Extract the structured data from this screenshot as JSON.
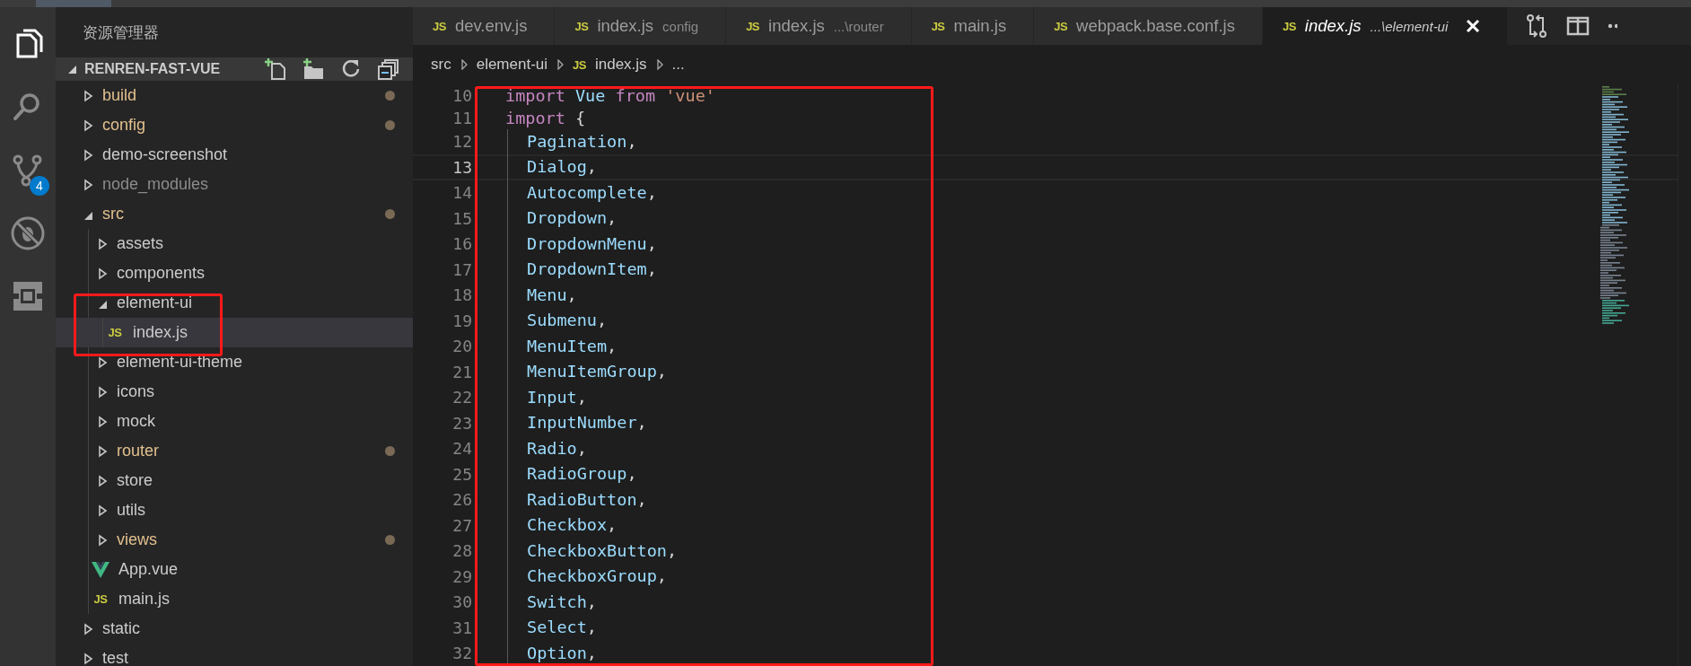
{
  "activity_bar": {
    "items": [
      {
        "kind": "explorer",
        "selected": true
      },
      {
        "kind": "search",
        "selected": false
      },
      {
        "kind": "scm",
        "selected": false,
        "badge": "4"
      },
      {
        "kind": "debug",
        "selected": false
      },
      {
        "kind": "extensions",
        "selected": false
      }
    ]
  },
  "sidebar": {
    "title": "资源管理器",
    "section": {
      "title": "RENREN-FAST-VUE",
      "expanded": true
    },
    "tree": [
      {
        "label": "build",
        "kind": "folder",
        "expanded": false,
        "modified": true,
        "ignored": false,
        "selected": false
      },
      {
        "label": "config",
        "kind": "folder",
        "expanded": false,
        "modified": true,
        "ignored": false,
        "selected": false
      },
      {
        "label": "demo-screenshot",
        "kind": "folder",
        "expanded": false,
        "modified": false,
        "ignored": false,
        "selected": false
      },
      {
        "label": "node_modules",
        "kind": "folder",
        "expanded": false,
        "modified": false,
        "ignored": true,
        "selected": false
      },
      {
        "label": "src",
        "kind": "folder",
        "expanded": true,
        "modified": true,
        "ignored": false,
        "selected": false,
        "children": [
          {
            "label": "assets",
            "kind": "folder",
            "expanded": false,
            "modified": false,
            "ignored": false,
            "selected": false
          },
          {
            "label": "components",
            "kind": "folder",
            "expanded": false,
            "modified": false,
            "ignored": false,
            "selected": false
          },
          {
            "label": "element-ui",
            "kind": "folder",
            "expanded": true,
            "modified": false,
            "ignored": false,
            "selected": false,
            "children": [
              {
                "label": "index.js",
                "kind": "js",
                "icon": "JS",
                "modified": false,
                "ignored": false,
                "selected": true
              }
            ]
          },
          {
            "label": "element-ui-theme",
            "kind": "folder",
            "expanded": false,
            "modified": false,
            "ignored": false,
            "selected": false
          },
          {
            "label": "icons",
            "kind": "folder",
            "expanded": false,
            "modified": false,
            "ignored": false,
            "selected": false
          },
          {
            "label": "mock",
            "kind": "folder",
            "expanded": false,
            "modified": false,
            "ignored": false,
            "selected": false
          },
          {
            "label": "router",
            "kind": "folder",
            "expanded": false,
            "modified": true,
            "ignored": false,
            "selected": false
          },
          {
            "label": "store",
            "kind": "folder",
            "expanded": false,
            "modified": false,
            "ignored": false,
            "selected": false
          },
          {
            "label": "utils",
            "kind": "folder",
            "expanded": false,
            "modified": false,
            "ignored": false,
            "selected": false
          },
          {
            "label": "views",
            "kind": "folder",
            "expanded": false,
            "modified": true,
            "ignored": false,
            "selected": false
          },
          {
            "label": "App.vue",
            "kind": "vue",
            "modified": false,
            "ignored": false,
            "selected": false
          },
          {
            "label": "main.js",
            "kind": "js",
            "icon": "JS",
            "modified": false,
            "ignored": false,
            "selected": false
          }
        ]
      },
      {
        "label": "static",
        "kind": "folder",
        "expanded": false,
        "modified": false,
        "ignored": false,
        "selected": false
      },
      {
        "label": "test",
        "kind": "folder",
        "expanded": false,
        "modified": false,
        "ignored": false,
        "selected": false
      }
    ]
  },
  "tabs": [
    {
      "icon": "JS",
      "label": "dev.env.js",
      "selected": false,
      "preview": false
    },
    {
      "icon": "JS",
      "label": "index.js",
      "description": "config",
      "selected": false,
      "preview": false
    },
    {
      "icon": "JS",
      "label": "index.js",
      "description": "...\\router",
      "selected": false,
      "preview": false
    },
    {
      "icon": "JS",
      "label": "main.js",
      "selected": false,
      "preview": false
    },
    {
      "icon": "JS",
      "label": "webpack.base.conf.js",
      "selected": false,
      "preview": false
    },
    {
      "icon": "JS",
      "label": "index.js",
      "description": "...\\element-ui",
      "selected": true,
      "preview": true
    }
  ],
  "breadcrumb": [
    {
      "label": "src"
    },
    {
      "label": "element-ui"
    },
    {
      "label": "index.js",
      "icon": "JS"
    },
    {
      "label": "..."
    }
  ],
  "code": [
    {
      "number": "10",
      "current": false,
      "indent": false,
      "tokens": [
        {
          "kind": "keyword",
          "text": "import "
        },
        {
          "kind": "variable",
          "text": "Vue "
        },
        {
          "kind": "keyword",
          "text": "from "
        },
        {
          "kind": "string",
          "text": "'vue'"
        }
      ]
    },
    {
      "number": "11",
      "current": false,
      "indent": false,
      "tokens": [
        {
          "kind": "keyword",
          "text": "import "
        },
        {
          "kind": "plain",
          "text": "{"
        }
      ]
    },
    {
      "number": "12",
      "current": false,
      "indent": true,
      "tokens": [
        {
          "kind": "variable",
          "text": "Pagination"
        },
        {
          "kind": "plain",
          "text": ","
        }
      ]
    },
    {
      "number": "13",
      "current": true,
      "indent": true,
      "tokens": [
        {
          "kind": "variable",
          "text": "Dialog"
        },
        {
          "kind": "plain",
          "text": ","
        }
      ]
    },
    {
      "number": "14",
      "current": false,
      "indent": true,
      "tokens": [
        {
          "kind": "variable",
          "text": "Autocomplete"
        },
        {
          "kind": "plain",
          "text": ","
        }
      ]
    },
    {
      "number": "15",
      "current": false,
      "indent": true,
      "tokens": [
        {
          "kind": "variable",
          "text": "Dropdown"
        },
        {
          "kind": "plain",
          "text": ","
        }
      ]
    },
    {
      "number": "16",
      "current": false,
      "indent": true,
      "tokens": [
        {
          "kind": "variable",
          "text": "DropdownMenu"
        },
        {
          "kind": "plain",
          "text": ","
        }
      ]
    },
    {
      "number": "17",
      "current": false,
      "indent": true,
      "tokens": [
        {
          "kind": "variable",
          "text": "DropdownItem"
        },
        {
          "kind": "plain",
          "text": ","
        }
      ]
    },
    {
      "number": "18",
      "current": false,
      "indent": true,
      "tokens": [
        {
          "kind": "variable",
          "text": "Menu"
        },
        {
          "kind": "plain",
          "text": ","
        }
      ]
    },
    {
      "number": "19",
      "current": false,
      "indent": true,
      "tokens": [
        {
          "kind": "variable",
          "text": "Submenu"
        },
        {
          "kind": "plain",
          "text": ","
        }
      ]
    },
    {
      "number": "20",
      "current": false,
      "indent": true,
      "tokens": [
        {
          "kind": "variable",
          "text": "MenuItem"
        },
        {
          "kind": "plain",
          "text": ","
        }
      ]
    },
    {
      "number": "21",
      "current": false,
      "indent": true,
      "tokens": [
        {
          "kind": "variable",
          "text": "MenuItemGroup"
        },
        {
          "kind": "plain",
          "text": ","
        }
      ]
    },
    {
      "number": "22",
      "current": false,
      "indent": true,
      "tokens": [
        {
          "kind": "variable",
          "text": "Input"
        },
        {
          "kind": "plain",
          "text": ","
        }
      ]
    },
    {
      "number": "23",
      "current": false,
      "indent": true,
      "tokens": [
        {
          "kind": "variable",
          "text": "InputNumber"
        },
        {
          "kind": "plain",
          "text": ","
        }
      ]
    },
    {
      "number": "24",
      "current": false,
      "indent": true,
      "tokens": [
        {
          "kind": "variable",
          "text": "Radio"
        },
        {
          "kind": "plain",
          "text": ","
        }
      ]
    },
    {
      "number": "25",
      "current": false,
      "indent": true,
      "tokens": [
        {
          "kind": "variable",
          "text": "RadioGroup"
        },
        {
          "kind": "plain",
          "text": ","
        }
      ]
    },
    {
      "number": "26",
      "current": false,
      "indent": true,
      "tokens": [
        {
          "kind": "variable",
          "text": "RadioButton"
        },
        {
          "kind": "plain",
          "text": ","
        }
      ]
    },
    {
      "number": "27",
      "current": false,
      "indent": true,
      "tokens": [
        {
          "kind": "variable",
          "text": "Checkbox"
        },
        {
          "kind": "plain",
          "text": ","
        }
      ]
    },
    {
      "number": "28",
      "current": false,
      "indent": true,
      "tokens": [
        {
          "kind": "variable",
          "text": "CheckboxButton"
        },
        {
          "kind": "plain",
          "text": ","
        }
      ]
    },
    {
      "number": "29",
      "current": false,
      "indent": true,
      "tokens": [
        {
          "kind": "variable",
          "text": "CheckboxGroup"
        },
        {
          "kind": "plain",
          "text": ","
        }
      ]
    },
    {
      "number": "30",
      "current": false,
      "indent": true,
      "tokens": [
        {
          "kind": "variable",
          "text": "Switch"
        },
        {
          "kind": "plain",
          "text": ","
        }
      ]
    },
    {
      "number": "31",
      "current": false,
      "indent": true,
      "tokens": [
        {
          "kind": "variable",
          "text": "Select"
        },
        {
          "kind": "plain",
          "text": ","
        }
      ]
    },
    {
      "number": "32",
      "current": false,
      "indent": true,
      "tokens": [
        {
          "kind": "variable",
          "text": "Option"
        },
        {
          "kind": "plain",
          "text": ","
        }
      ]
    }
  ],
  "sidebar_highlight_frame": true,
  "code_highlight_frame": true
}
